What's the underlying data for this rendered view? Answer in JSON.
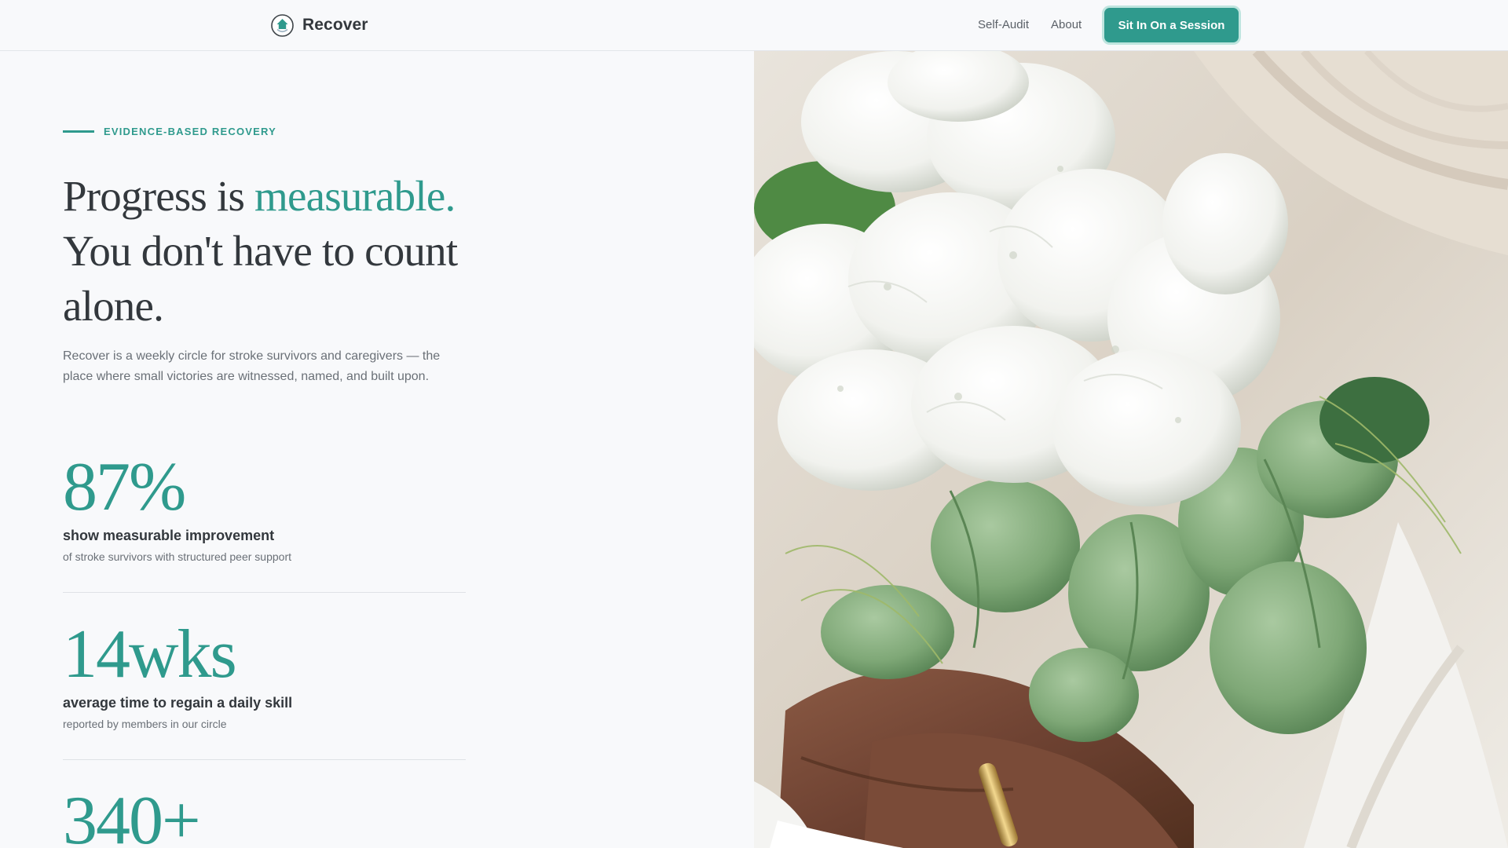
{
  "header": {
    "brand_name": "Recover",
    "nav": [
      {
        "label": "Self-Audit"
      },
      {
        "label": "About"
      }
    ],
    "cta_label": "Sit In On a Session"
  },
  "hero": {
    "eyebrow": "EVIDENCE-BASED RECOVERY",
    "headline_part1": "Progress is ",
    "headline_accent": "measurable.",
    "headline_part2": "You don't have to count alone.",
    "lede": "Recover is a weekly circle for stroke survivors and caregivers — the place where small victories are witnessed, named, and built upon."
  },
  "stats": [
    {
      "value": "87%",
      "label": "show measurable improvement",
      "sub": "of stroke survivors with structured peer support"
    },
    {
      "value": "14wks",
      "label": "average time to regain a daily skill",
      "sub": "reported by members in our circle"
    },
    {
      "value": "340+"
    }
  ],
  "colors": {
    "accent": "#2f9a8d",
    "text": "#33383d",
    "muted": "#6a7077",
    "background": "#f8f9fb"
  },
  "icons": {
    "brand_logo": "house-in-circle-icon"
  }
}
